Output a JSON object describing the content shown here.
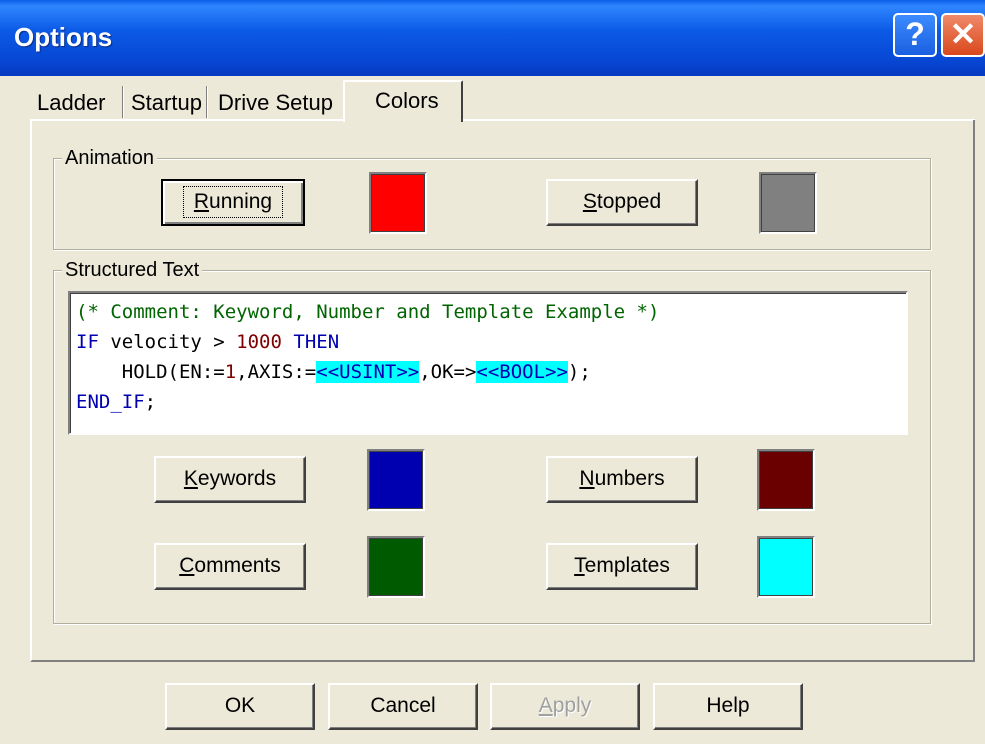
{
  "window": {
    "title": "Options",
    "help_glyph": "?",
    "close_glyph": "✕"
  },
  "tabs": [
    {
      "label": "Ladder"
    },
    {
      "label": "Startup"
    },
    {
      "label": "Drive Setup"
    },
    {
      "label": "Colors",
      "active": true
    }
  ],
  "animation": {
    "legend": "Animation",
    "running_label": "Running",
    "stopped_label": "Stopped",
    "running_color": "#ff0000",
    "stopped_color": "#808080"
  },
  "structured_text": {
    "legend": "Structured Text",
    "line1_comment": "(* Comment: Keyword, Number and Template Example *)",
    "line2_kw1": "IF",
    "line2_plain": " velocity > ",
    "line2_num": "1000",
    "line2_kw2": " THEN",
    "line3_a": "    HOLD(EN:=",
    "line3_num": "1",
    "line3_b": ",AXIS:=",
    "line3_tpl1": "<<USINT>>",
    "line3_c": ",OK=>",
    "line3_tpl2": "<<BOOL>>",
    "line3_d": ");",
    "line4_kw": "END_IF",
    "line4_end": ";",
    "keywords_label": "Keywords",
    "numbers_label": "Numbers",
    "comments_label": "Comments",
    "templates_label": "Templates",
    "keywords_color": "#0000b0",
    "numbers_color": "#6b0000",
    "comments_color": "#005a00",
    "templates_color": "#00ffff"
  },
  "footer": {
    "ok": "OK",
    "cancel": "Cancel",
    "apply": "Apply",
    "help": "Help"
  }
}
